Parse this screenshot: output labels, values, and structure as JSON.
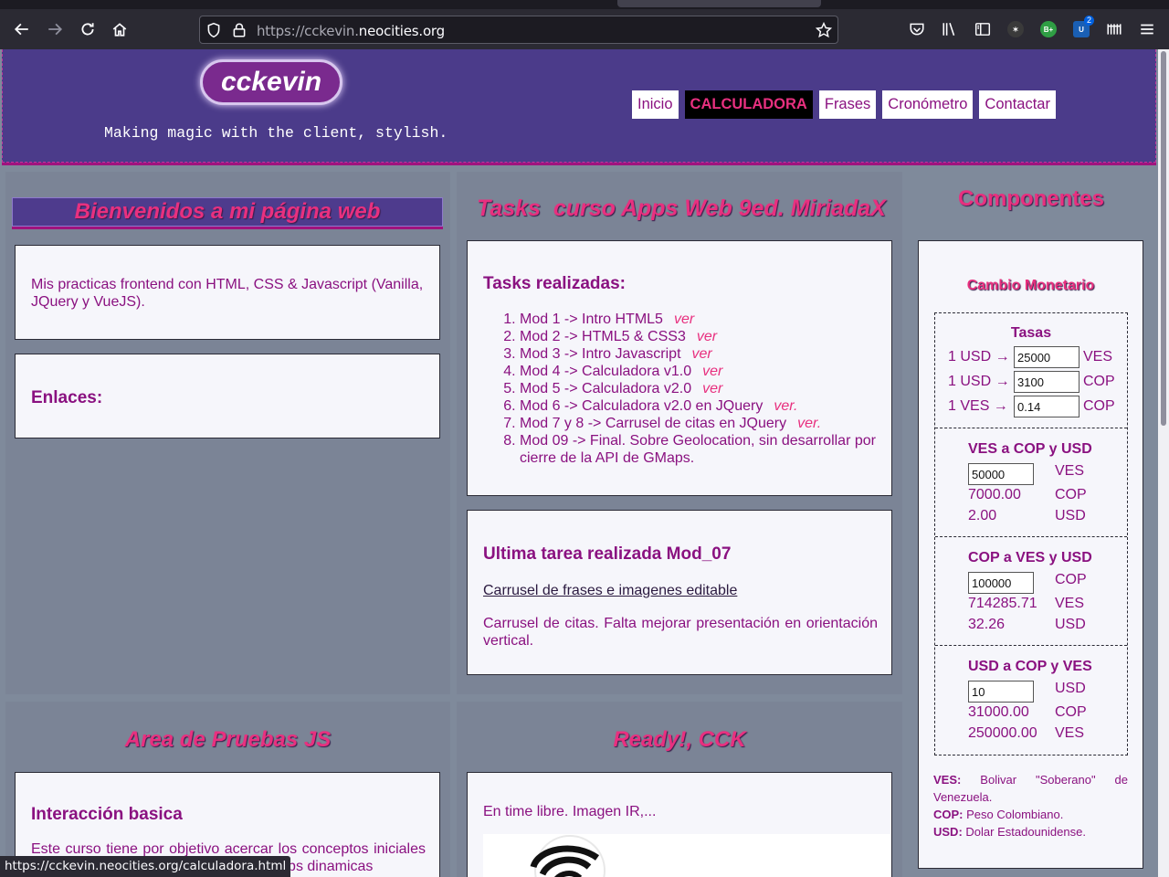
{
  "browser": {
    "url_prefix": "https://cckevin.",
    "url_domain": "neocities.org",
    "status_url": "https://cckevin.neocities.org/calculadora.html",
    "ext_badge": "2",
    "ext_b_label": "B+"
  },
  "header": {
    "logo": "cckevin",
    "tagline": "Making magic with the client, stylish.",
    "nav": [
      "Inicio",
      "CALCULADORA",
      "Frases",
      "Cronómetro",
      "Contactar"
    ]
  },
  "left": {
    "welcome": "Bienvenidos a mi página web",
    "intro": "Mis practicas frontend con HTML, CSS & Javascript (Vanilla, JQuery y VueJS).",
    "links_title": "Enlaces:"
  },
  "middle": {
    "title": "Tasks  curso Apps Web 9ed. MiriadaX",
    "tasks_heading": "Tasks realizadas:",
    "tasks": [
      {
        "text": "Mod 1 -> Intro HTML5",
        "link": "ver"
      },
      {
        "text": "Mod 2 -> HTML5 & CSS3",
        "link": "ver"
      },
      {
        "text": "Mod 3 -> Intro Javascript",
        "link": "ver"
      },
      {
        "text": "Mod 4 -> Calculadora v1.0",
        "link": "ver"
      },
      {
        "text": "Mod 5 -> Calculadora v2.0",
        "link": "ver"
      },
      {
        "text": "Mod 6 -> Calculadora v2.0 en JQuery",
        "link": "ver."
      },
      {
        "text": "Mod 7 y 8 -> Carrusel de citas en JQuery",
        "link": "ver."
      },
      {
        "text": "Mod 09 -> Final. Sobre Geolocation, sin desarrollar por cierre de la API de GMaps.",
        "link": ""
      }
    ],
    "last_heading": "Ultima tarea realizada Mod_07",
    "last_link": "Carrusel de frases e imagenes editable",
    "last_desc": "Carrusel de citas. Falta mejorar presentación en orientación vertical."
  },
  "components": {
    "title": "Componentes",
    "cambio_title": "Cambio Monetario",
    "tasas_title": "Tasas",
    "rates": [
      {
        "label": "1 USD →",
        "value": "25000",
        "cur": "VES"
      },
      {
        "label": "1 USD →",
        "value": "3100",
        "cur": "COP"
      },
      {
        "label": "1 VES →",
        "value": "0.14",
        "cur": "COP"
      }
    ],
    "sections": [
      {
        "title": "VES a COP y USD",
        "input": "50000",
        "input_cur": "VES",
        "results": [
          {
            "v": "7000.00",
            "c": "COP"
          },
          {
            "v": "2.00",
            "c": "USD"
          }
        ]
      },
      {
        "title": "COP a VES y USD",
        "input": "100000",
        "input_cur": "COP",
        "results": [
          {
            "v": "714285.71",
            "c": "VES"
          },
          {
            "v": "32.26",
            "c": "USD"
          }
        ]
      },
      {
        "title": "USD a COP y VES",
        "input": "10",
        "input_cur": "USD",
        "results": [
          {
            "v": "31000.00",
            "c": "COP"
          },
          {
            "v": "250000.00",
            "c": "VES"
          }
        ]
      }
    ],
    "legend": [
      {
        "k": "VES:",
        "v": "Bolivar \"Soberano\" de Venezuela."
      },
      {
        "k": "COP:",
        "v": "Peso Colombiano."
      },
      {
        "k": "USD:",
        "v": "Dolar Estadounidense."
      }
    ]
  },
  "bottom": {
    "area_title": "Area de Pruebas JS",
    "inter_heading": "Interacción basica",
    "inter_text": "Este curso tiene por objetivo acercar los conceptos iniciales de programación del cliente y de las webs dinamicas",
    "ready_title": "Ready!, CCK",
    "ready_text": "En time libre. Imagen IR,..."
  }
}
